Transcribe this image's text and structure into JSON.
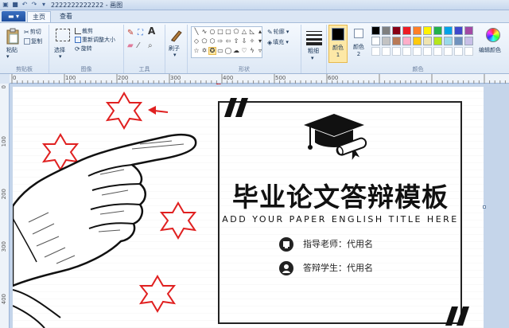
{
  "window": {
    "title": "2222222222222 - 画图",
    "quick_access": [
      "save-icon",
      "undo-icon",
      "redo-icon",
      "customize-icon"
    ]
  },
  "tabs": {
    "file_label": "",
    "items": [
      {
        "label": "主页",
        "active": true
      },
      {
        "label": "查看",
        "active": false
      }
    ]
  },
  "ribbon": {
    "clipboard": {
      "label": "剪贴板",
      "paste": "粘贴",
      "cut": "剪切",
      "copy": "复制"
    },
    "image": {
      "label": "图像",
      "select": "选择",
      "crop": "裁剪",
      "resize": "重新调整大小",
      "rotate": "旋转"
    },
    "tools": {
      "label": "工具"
    },
    "brushes": {
      "label": "刷子"
    },
    "shapes": {
      "label": "形状",
      "outline": "轮廓",
      "fill": "填充"
    },
    "size": {
      "label": "粗细"
    },
    "colors": {
      "label": "颜色",
      "color1": "颜色 1",
      "color2": "颜色 2",
      "edit": "编辑颜色",
      "color1_value": "#000000",
      "color2_value": "#ffffff",
      "palette_row1": [
        "#000000",
        "#7f7f7f",
        "#880015",
        "#ed1c24",
        "#ff7f27",
        "#fff200",
        "#22b14c",
        "#00a2e8",
        "#3f48cc",
        "#a349a4"
      ],
      "palette_row2": [
        "#ffffff",
        "#c3c3c3",
        "#b97a57",
        "#ffaec9",
        "#ffc90e",
        "#efe4b0",
        "#b5e61d",
        "#99d9ea",
        "#7092be",
        "#c8bfe7"
      ]
    }
  },
  "rulers": {
    "horizontal": [
      "0",
      "100",
      "200",
      "300",
      "400",
      "500",
      "600"
    ],
    "vertical": [
      "0",
      "100",
      "200",
      "300",
      "400"
    ]
  },
  "canvas": {
    "title": "毕业论文答辩模板",
    "subtitle": "ADD YOUR PAPER ENGLISH TITLE HERE",
    "advisor": "指导老师：代用名",
    "student": "答辩学生：代用名",
    "accent_color": "#e02020"
  }
}
